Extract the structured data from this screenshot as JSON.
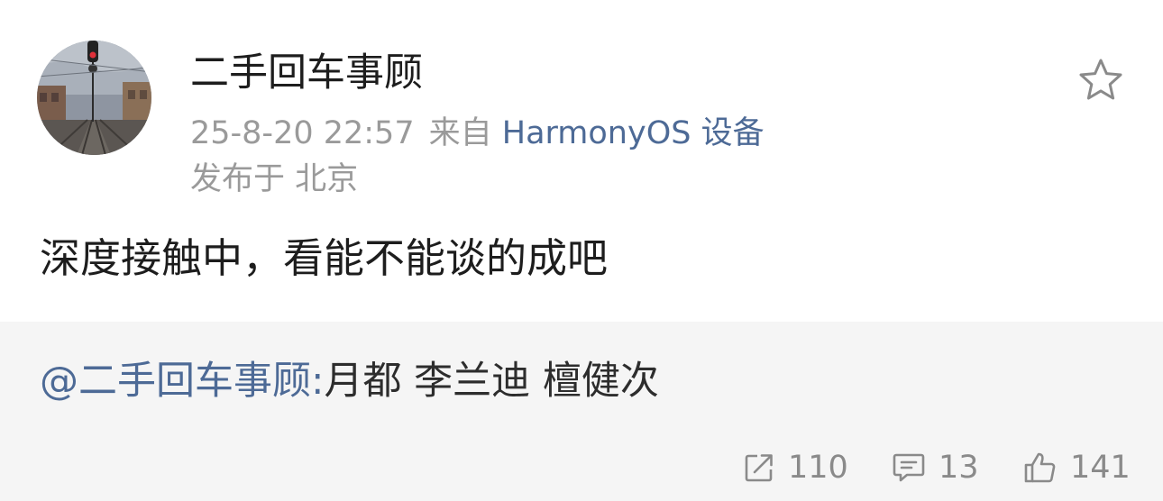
{
  "post": {
    "author": "二手回车事顾",
    "timestamp": "25-8-20 22:57",
    "source_prefix": "来自",
    "source_name": "HarmonyOS 设备",
    "location": "发布于 北京",
    "text": "深度接触中，看能不能谈的成吧",
    "avatar_icon": "railway-track-photo"
  },
  "repost": {
    "mention": "@二手回车事顾:",
    "text": "月都 李兰迪 檀健次"
  },
  "actions": {
    "share_count": "110",
    "comment_count": "13",
    "like_count": "141"
  },
  "colors": {
    "link": "#4d6a96",
    "secondary_text": "#9a9a9a",
    "repost_background": "#f5f5f5",
    "action_gray": "#8a8a8a"
  }
}
